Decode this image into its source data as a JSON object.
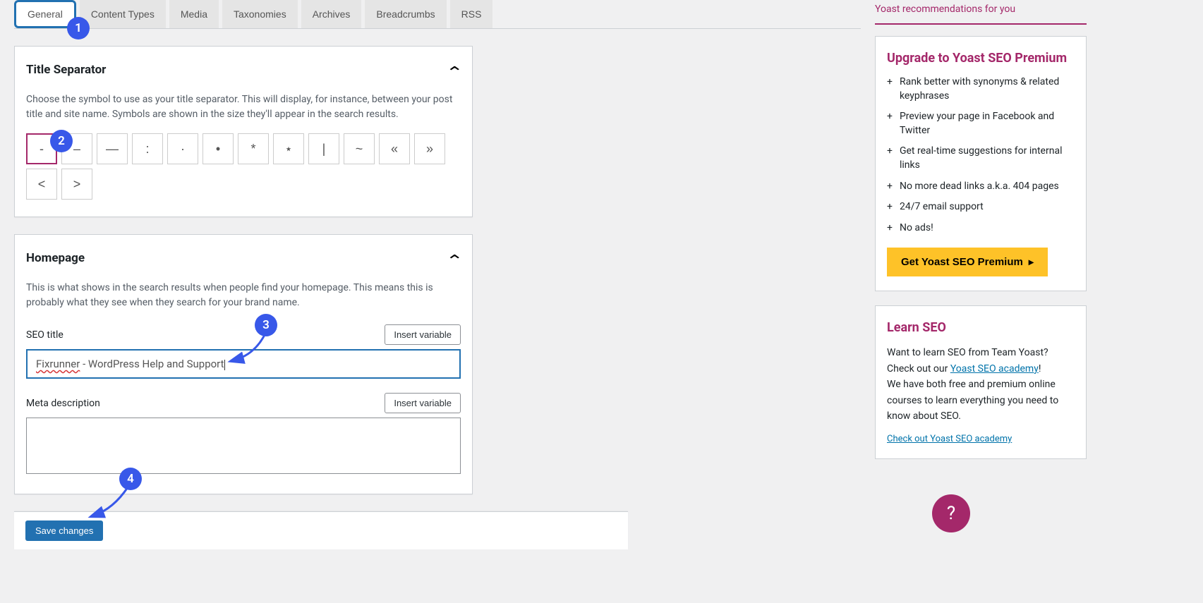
{
  "tabs": [
    "General",
    "Content Types",
    "Media",
    "Taxonomies",
    "Archives",
    "Breadcrumbs",
    "RSS"
  ],
  "title_separator": {
    "heading": "Title Separator",
    "description": "Choose the symbol to use as your title separator. This will display, for instance, between your post title and site name. Symbols are shown in the size they'll appear in the search results.",
    "options": [
      "-",
      "–",
      "—",
      ":",
      "·",
      "•",
      "*",
      "⋆",
      "|",
      "~",
      "«",
      "»",
      "<",
      ">"
    ],
    "selected_index": 0
  },
  "homepage": {
    "heading": "Homepage",
    "description": "This is what shows in the search results when people find your homepage. This means this is probably what they see when they search for your brand name.",
    "seo_title_label": "SEO title",
    "seo_title_value_pre": "Fixrunner",
    "seo_title_value_post": " - WordPress Help and Support",
    "meta_desc_label": "Meta description",
    "insert_variable_label": "Insert variable"
  },
  "save_label": "Save changes",
  "sidebar": {
    "recommendations_title": "Yoast recommendations for you",
    "premium": {
      "heading": "Upgrade to Yoast SEO Premium",
      "benefits": [
        "Rank better with synonyms & related keyphrases",
        "Preview your page in Facebook and Twitter",
        "Get real-time suggestions for internal links",
        "No more dead links a.k.a. 404 pages",
        "24/7 email support",
        "No ads!"
      ],
      "cta": "Get Yoast SEO Premium"
    },
    "learn": {
      "heading": "Learn SEO",
      "desc1a": "Want to learn SEO from Team Yoast? Check out our ",
      "link1": "Yoast SEO academy",
      "desc1b": "!",
      "desc2": "We have both free and premium online courses to learn everything you need to know about SEO.",
      "link2": "Check out Yoast SEO academy"
    }
  },
  "annotations": {
    "b1": "1",
    "b2": "2",
    "b3": "3",
    "b4": "4"
  },
  "help_glyph": "?"
}
